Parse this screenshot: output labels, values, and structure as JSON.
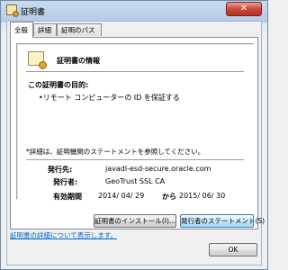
{
  "window": {
    "title": "証明書",
    "close_glyph": "✕"
  },
  "tabs": [
    {
      "label": "全般"
    },
    {
      "label": "詳細"
    },
    {
      "label": "証明のパス"
    }
  ],
  "info": {
    "title": "証明書の情報",
    "purpose_heading": "この証明書の目的:",
    "purpose_items": [
      "•リモート コンピューターの ID を保証する"
    ],
    "note": "*詳細は、証明機関のステートメントを参照してください。",
    "issued_to_label": "発行先:",
    "issued_to_value": "javadl-esd-secure.oracle.com",
    "issued_by_label": "発行者:",
    "issued_by_value": "GeoTrust SSL CA",
    "validity_label": "有効期間",
    "valid_from": "2014/ 04/ 29",
    "valid_to_word": "から",
    "valid_to": "2015/ 06/ 30"
  },
  "buttons": {
    "install": "証明書のインストール(I)...",
    "issuer_statement": "発行者のステートメント(S)",
    "ok": "OK"
  },
  "link": "証明書の詳細について表示します。"
}
